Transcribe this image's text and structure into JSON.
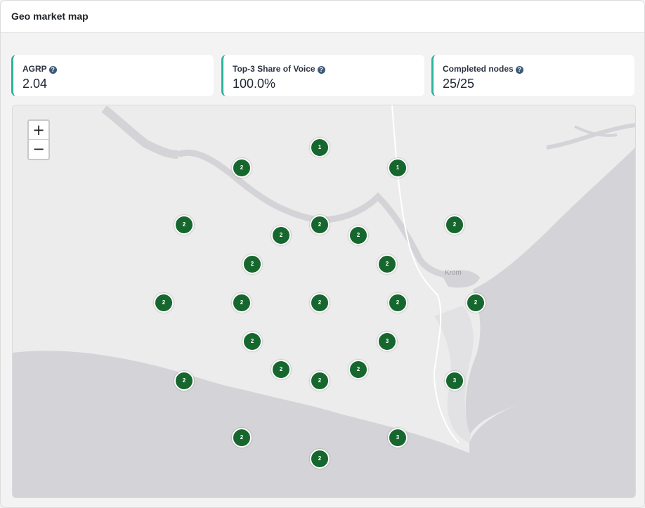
{
  "header": {
    "title": "Geo market map"
  },
  "kpis": [
    {
      "label": "AGRP",
      "value": "2.04"
    },
    {
      "label": "Top-3 Share of Voice",
      "value": "100.0%"
    },
    {
      "label": "Completed nodes",
      "value": "25/25"
    }
  ],
  "map": {
    "zoom_in_label": "+",
    "zoom_out_label": "−",
    "place_label": "Krom",
    "markers": [
      "1",
      "1",
      "2",
      "2",
      "2",
      "2",
      "2",
      "2",
      "2",
      "2",
      "2",
      "2",
      "2",
      "2",
      "2",
      "2",
      "3",
      "2",
      "2",
      "2",
      "3",
      "2",
      "2",
      "3",
      "2"
    ]
  },
  "colors": {
    "accent": "#2bb59a",
    "marker": "#16672e",
    "sea": "#d4d4d8",
    "land": "#ececec"
  }
}
